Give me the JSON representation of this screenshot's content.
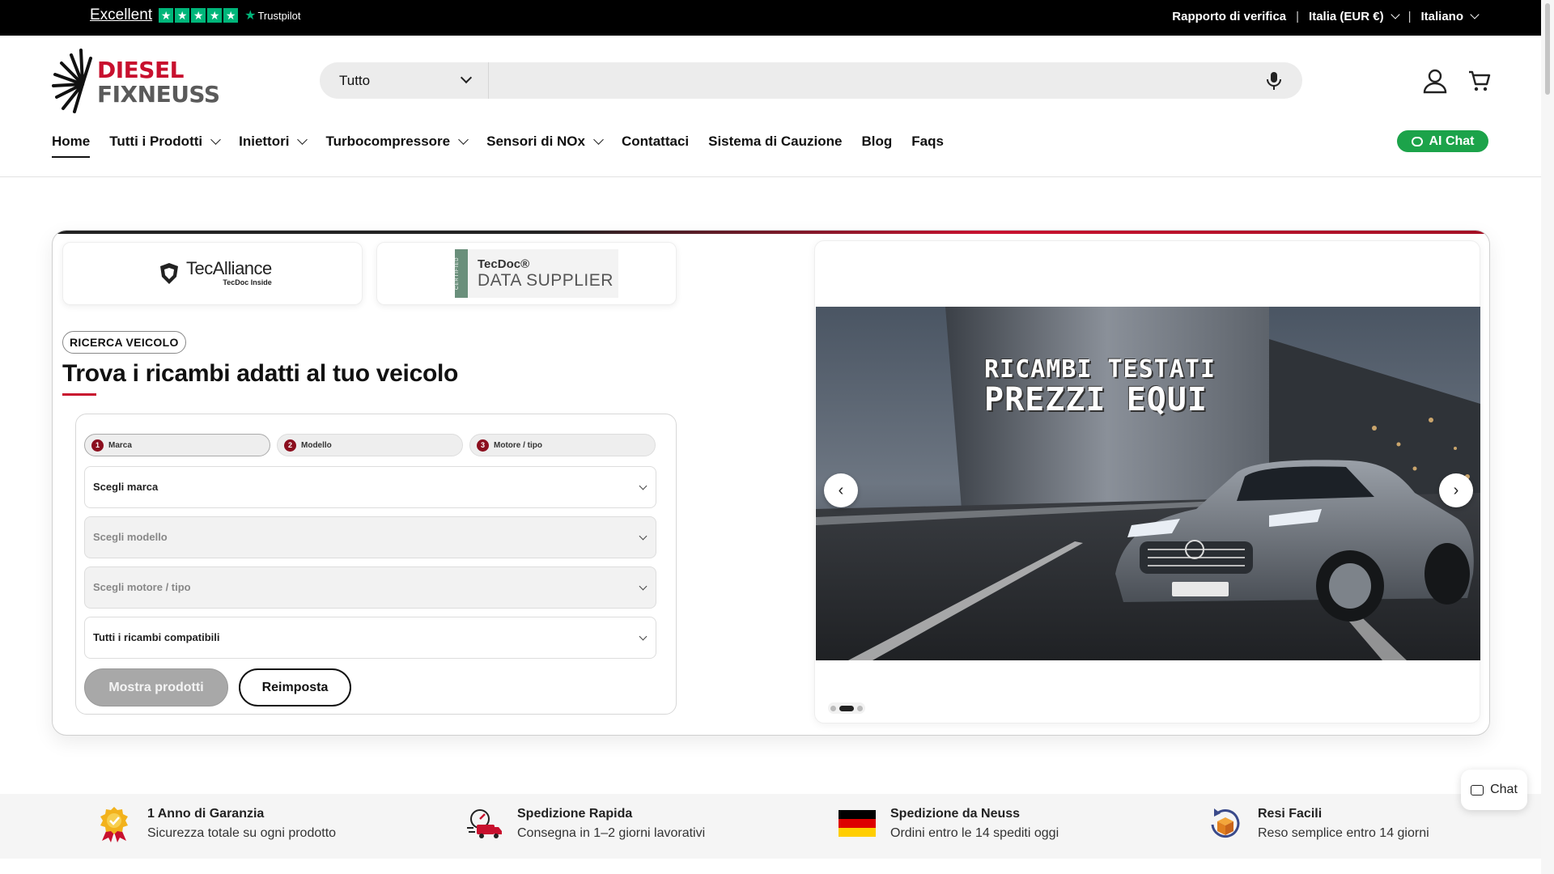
{
  "topbar": {
    "trustpilot_rating": "Excellent",
    "trustpilot_brand": "Trustpilot",
    "stars": 5,
    "verify_report": "Rapporto di verifica",
    "region": "Italia (EUR €)",
    "language": "Italiano"
  },
  "logo": {
    "line1": "DIESEL",
    "line2": "FIXNEUSS"
  },
  "search": {
    "category": "Tutto",
    "placeholder": ""
  },
  "nav": {
    "items": [
      {
        "label": "Home"
      },
      {
        "label": "Tutti i Prodotti"
      },
      {
        "label": "Iniettori"
      },
      {
        "label": "Turbocompressore"
      },
      {
        "label": "Sensori di NOx"
      },
      {
        "label": "Contattaci"
      },
      {
        "label": "Sistema di Cauzione"
      },
      {
        "label": "Blog"
      },
      {
        "label": "Faqs"
      }
    ],
    "ai_chat": "AI Chat"
  },
  "badges": {
    "tecalliance": "TecAlliance",
    "tecalliance_sub": "TecDoc Inside",
    "certified": "CERTIFIED",
    "tecdoc": "TecDoc®",
    "data_supplier": "DATA SUPPLIER"
  },
  "finder": {
    "badge": "RICERCA VEICOLO",
    "heading": "Trova i ricambi adatti al tuo veicolo",
    "steps": [
      {
        "num": "1",
        "label": "Marca"
      },
      {
        "num": "2",
        "label": "Modello"
      },
      {
        "num": "3",
        "label": "Motore / tipo"
      }
    ],
    "selects": [
      "Scegli marca",
      "Scegli modello",
      "Scegli motore / tipo",
      "Tutti i ricambi compatibili"
    ],
    "show_button": "Mostra prodotti",
    "reset_button": "Reimposta"
  },
  "slider": {
    "caption_line1": "RICAMBI TESTATI",
    "caption_line2": "PREZZI EQUI",
    "prev": "‹",
    "next": "›",
    "slide_count": 3,
    "active_slide": 2
  },
  "features": [
    {
      "title": "1 Anno di Garanzia",
      "subtitle": "Sicurezza totale su ogni prodotto",
      "icon": "warranty-badge-icon"
    },
    {
      "title": "Spedizione Rapida",
      "subtitle": "Consegna in 1–2 giorni lavorativi",
      "icon": "fast-delivery-icon"
    },
    {
      "title": "Spedizione da Neuss",
      "subtitle": "Ordini entro le 14 spediti oggi",
      "icon": "german-flag-icon"
    },
    {
      "title": "Resi Facili",
      "subtitle": "Reso semplice entro 14 giorni",
      "icon": "return-box-icon"
    }
  ],
  "chat_widget": "Chat",
  "colors": {
    "brand_red": "#c8102e",
    "trustpilot_green": "#00b67a",
    "ai_chat_green": "#1ca34a"
  }
}
